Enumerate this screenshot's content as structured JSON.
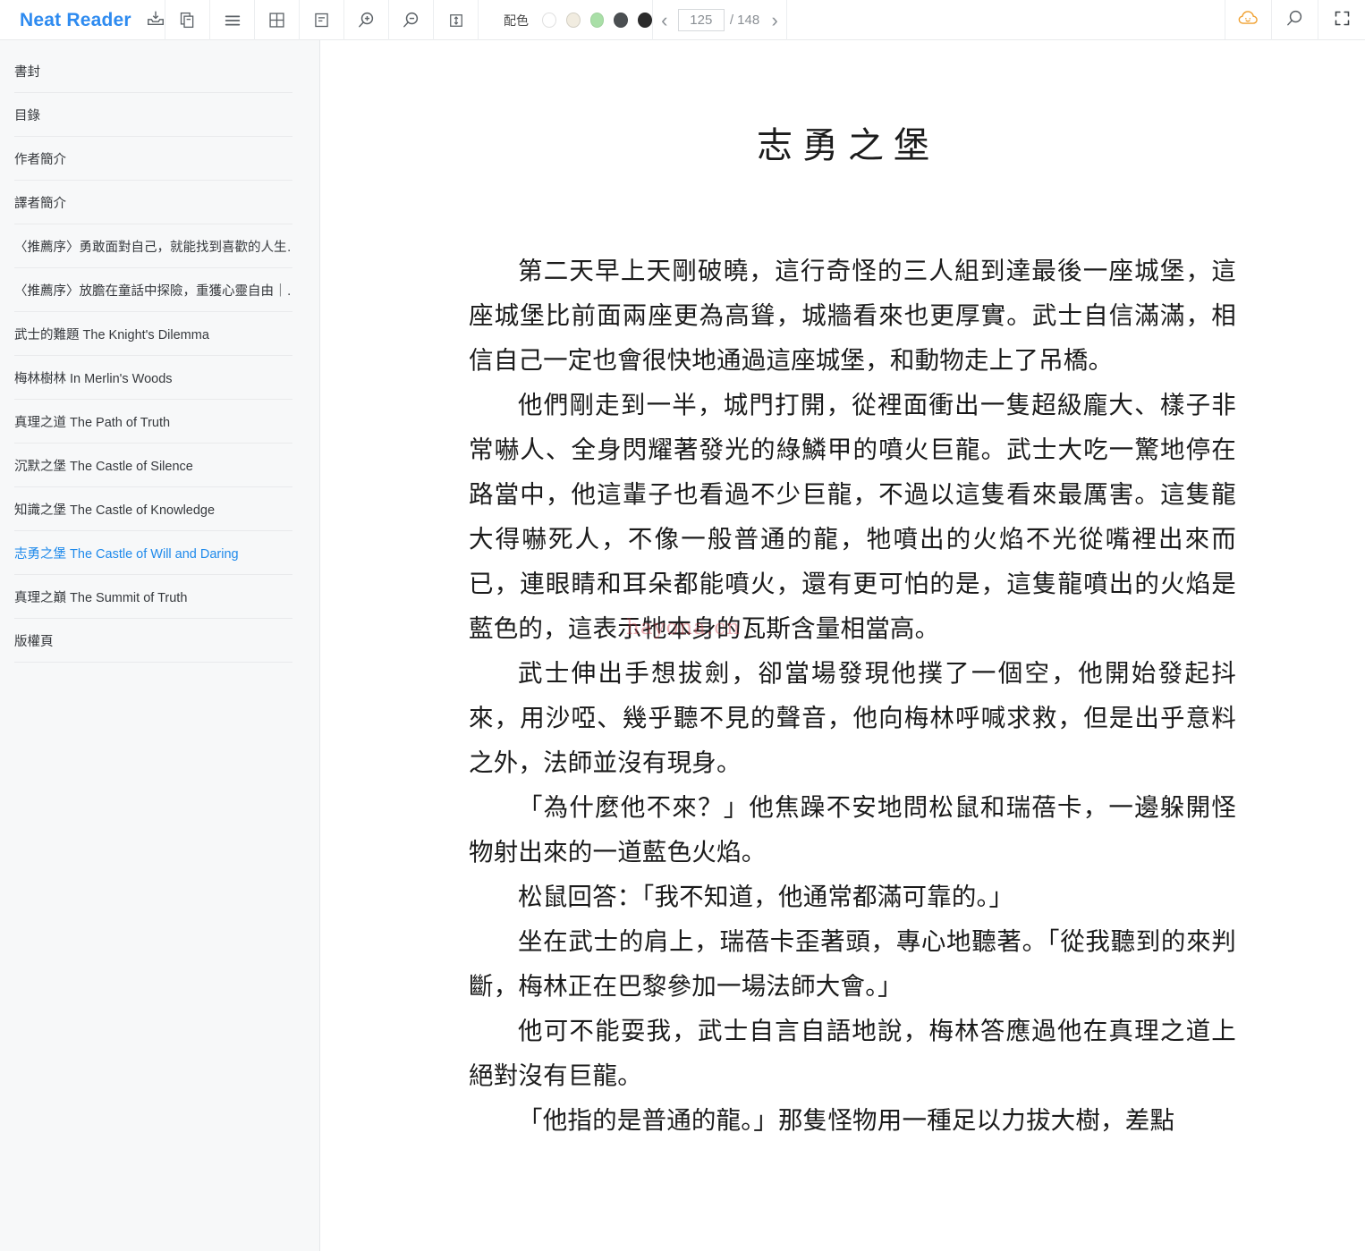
{
  "app": {
    "name": "Neat Reader",
    "brand_color": "#2e8bf0"
  },
  "toolbar": {
    "icons": [
      {
        "name": "save-to-device-icon",
        "label": "下載"
      },
      {
        "name": "copy-icon",
        "label": "複製"
      },
      {
        "name": "list-view-icon",
        "label": "列表"
      },
      {
        "name": "grid-view-icon",
        "label": "網格"
      },
      {
        "name": "note-icon",
        "label": "筆記"
      },
      {
        "name": "zoom-in-icon",
        "label": "放大"
      },
      {
        "name": "zoom-out-icon",
        "label": "縮小"
      },
      {
        "name": "line-height-icon",
        "label": "行距"
      }
    ],
    "color_scheme": {
      "label": "配色",
      "swatches": [
        {
          "name": "swatch-white",
          "color": "#ffffff",
          "selected": true
        },
        {
          "name": "swatch-cream",
          "color": "#f1ece0"
        },
        {
          "name": "swatch-green",
          "color": "#a9dfa7"
        },
        {
          "name": "swatch-dark-gray",
          "color": "#4b4f52"
        },
        {
          "name": "swatch-black",
          "color": "#2b2b2b"
        }
      ]
    },
    "pager": {
      "prev_label": "‹",
      "next_label": "›",
      "current_page": "125",
      "page_placeholder": "125",
      "total_label": "/ 148",
      "total_pages": "148"
    },
    "right_icons": [
      {
        "name": "cloud-sync-icon",
        "label": "雲端同步",
        "color": "#f0a030"
      },
      {
        "name": "search-icon",
        "label": "搜尋"
      },
      {
        "name": "fullscreen-icon",
        "label": "全螢幕"
      }
    ]
  },
  "sidebar": {
    "items": [
      {
        "label": "書封",
        "active": false
      },
      {
        "label": "目錄",
        "active": false
      },
      {
        "label": "作者簡介",
        "active": false
      },
      {
        "label": "譯者簡介",
        "active": false
      },
      {
        "label": "〈推薦序〉勇敢面對自己，就能找到喜歡的人生…",
        "active": false
      },
      {
        "label": "〈推薦序〉放膽在童話中探險，重獲心靈自由｜…",
        "active": false
      },
      {
        "label": "武士的難題 The Knight's Dilemma",
        "active": false
      },
      {
        "label": "梅林樹林 In Merlin's Woods",
        "active": false
      },
      {
        "label": "真理之道 The Path of Truth",
        "active": false
      },
      {
        "label": "沉默之堡 The Castle of Silence",
        "active": false
      },
      {
        "label": "知識之堡 The Castle of Knowledge",
        "active": false
      },
      {
        "label": "志勇之堡 The Castle of Will and Daring",
        "active": true
      },
      {
        "label": "真理之巔 The Summit of Truth",
        "active": false
      },
      {
        "label": "版權頁",
        "active": false
      }
    ]
  },
  "content": {
    "title": "志勇之堡",
    "watermark": "hayona.cn",
    "paragraphs": [
      "第二天早上天剛破曉，這行奇怪的三人組到達最後一座城堡，這座城堡比前面兩座更為高聳，城牆看來也更厚實。武士自信滿滿，相信自己一定也會很快地通過這座城堡，和動物走上了吊橋。",
      "他們剛走到一半，城門打開，從裡面衝出一隻超級龐大、樣子非常嚇人、全身閃耀著發光的綠鱗甲的噴火巨龍。武士大吃一驚地停在路當中，他這輩子也看過不少巨龍，不過以這隻看來最厲害。這隻龍大得嚇死人，不像一般普通的龍，牠噴出的火焰不光從嘴裡出來而已，連眼睛和耳朵都能噴火，還有更可怕的是，這隻龍噴出的火焰是藍色的，這表示牠本身的瓦斯含量相當高。",
      "武士伸出手想拔劍，卻當場發現他撲了一個空，他開始發起抖來，用沙啞、幾乎聽不見的聲音，他向梅林呼喊求救，但是出乎意料之外，法師並沒有現身。",
      "「為什麼他不來？」他焦躁不安地問松鼠和瑞蓓卡，一邊躲開怪物射出來的一道藍色火焰。",
      "松鼠回答：「我不知道，他通常都滿可靠的。」",
      "坐在武士的肩上，瑞蓓卡歪著頭，專心地聽著。「從我聽到的來判斷，梅林正在巴黎參加一場法師大會。」",
      "他可不能耍我，武士自言自語地說，梅林答應過他在真理之道上絕對沒有巨龍。",
      "「他指的是普通的龍。」那隻怪物用一種足以力拔大樹，差點"
    ]
  }
}
